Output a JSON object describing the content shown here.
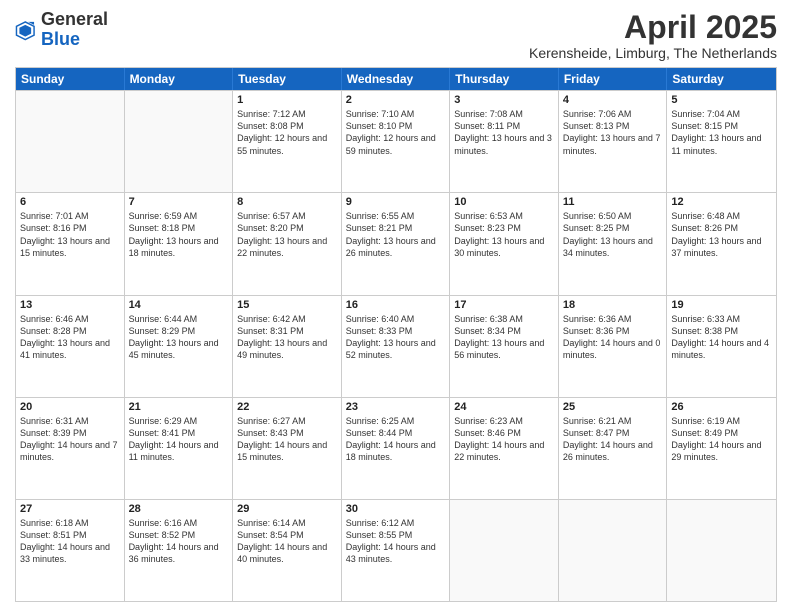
{
  "logo": {
    "general": "General",
    "blue": "Blue"
  },
  "title": "April 2025",
  "subtitle": "Kerensheide, Limburg, The Netherlands",
  "days_of_week": [
    "Sunday",
    "Monday",
    "Tuesday",
    "Wednesday",
    "Thursday",
    "Friday",
    "Saturday"
  ],
  "weeks": [
    [
      {
        "day": "",
        "info": ""
      },
      {
        "day": "",
        "info": ""
      },
      {
        "day": "1",
        "info": "Sunrise: 7:12 AM\nSunset: 8:08 PM\nDaylight: 12 hours and 55 minutes."
      },
      {
        "day": "2",
        "info": "Sunrise: 7:10 AM\nSunset: 8:10 PM\nDaylight: 12 hours and 59 minutes."
      },
      {
        "day": "3",
        "info": "Sunrise: 7:08 AM\nSunset: 8:11 PM\nDaylight: 13 hours and 3 minutes."
      },
      {
        "day": "4",
        "info": "Sunrise: 7:06 AM\nSunset: 8:13 PM\nDaylight: 13 hours and 7 minutes."
      },
      {
        "day": "5",
        "info": "Sunrise: 7:04 AM\nSunset: 8:15 PM\nDaylight: 13 hours and 11 minutes."
      }
    ],
    [
      {
        "day": "6",
        "info": "Sunrise: 7:01 AM\nSunset: 8:16 PM\nDaylight: 13 hours and 15 minutes."
      },
      {
        "day": "7",
        "info": "Sunrise: 6:59 AM\nSunset: 8:18 PM\nDaylight: 13 hours and 18 minutes."
      },
      {
        "day": "8",
        "info": "Sunrise: 6:57 AM\nSunset: 8:20 PM\nDaylight: 13 hours and 22 minutes."
      },
      {
        "day": "9",
        "info": "Sunrise: 6:55 AM\nSunset: 8:21 PM\nDaylight: 13 hours and 26 minutes."
      },
      {
        "day": "10",
        "info": "Sunrise: 6:53 AM\nSunset: 8:23 PM\nDaylight: 13 hours and 30 minutes."
      },
      {
        "day": "11",
        "info": "Sunrise: 6:50 AM\nSunset: 8:25 PM\nDaylight: 13 hours and 34 minutes."
      },
      {
        "day": "12",
        "info": "Sunrise: 6:48 AM\nSunset: 8:26 PM\nDaylight: 13 hours and 37 minutes."
      }
    ],
    [
      {
        "day": "13",
        "info": "Sunrise: 6:46 AM\nSunset: 8:28 PM\nDaylight: 13 hours and 41 minutes."
      },
      {
        "day": "14",
        "info": "Sunrise: 6:44 AM\nSunset: 8:29 PM\nDaylight: 13 hours and 45 minutes."
      },
      {
        "day": "15",
        "info": "Sunrise: 6:42 AM\nSunset: 8:31 PM\nDaylight: 13 hours and 49 minutes."
      },
      {
        "day": "16",
        "info": "Sunrise: 6:40 AM\nSunset: 8:33 PM\nDaylight: 13 hours and 52 minutes."
      },
      {
        "day": "17",
        "info": "Sunrise: 6:38 AM\nSunset: 8:34 PM\nDaylight: 13 hours and 56 minutes."
      },
      {
        "day": "18",
        "info": "Sunrise: 6:36 AM\nSunset: 8:36 PM\nDaylight: 14 hours and 0 minutes."
      },
      {
        "day": "19",
        "info": "Sunrise: 6:33 AM\nSunset: 8:38 PM\nDaylight: 14 hours and 4 minutes."
      }
    ],
    [
      {
        "day": "20",
        "info": "Sunrise: 6:31 AM\nSunset: 8:39 PM\nDaylight: 14 hours and 7 minutes."
      },
      {
        "day": "21",
        "info": "Sunrise: 6:29 AM\nSunset: 8:41 PM\nDaylight: 14 hours and 11 minutes."
      },
      {
        "day": "22",
        "info": "Sunrise: 6:27 AM\nSunset: 8:43 PM\nDaylight: 14 hours and 15 minutes."
      },
      {
        "day": "23",
        "info": "Sunrise: 6:25 AM\nSunset: 8:44 PM\nDaylight: 14 hours and 18 minutes."
      },
      {
        "day": "24",
        "info": "Sunrise: 6:23 AM\nSunset: 8:46 PM\nDaylight: 14 hours and 22 minutes."
      },
      {
        "day": "25",
        "info": "Sunrise: 6:21 AM\nSunset: 8:47 PM\nDaylight: 14 hours and 26 minutes."
      },
      {
        "day": "26",
        "info": "Sunrise: 6:19 AM\nSunset: 8:49 PM\nDaylight: 14 hours and 29 minutes."
      }
    ],
    [
      {
        "day": "27",
        "info": "Sunrise: 6:18 AM\nSunset: 8:51 PM\nDaylight: 14 hours and 33 minutes."
      },
      {
        "day": "28",
        "info": "Sunrise: 6:16 AM\nSunset: 8:52 PM\nDaylight: 14 hours and 36 minutes."
      },
      {
        "day": "29",
        "info": "Sunrise: 6:14 AM\nSunset: 8:54 PM\nDaylight: 14 hours and 40 minutes."
      },
      {
        "day": "30",
        "info": "Sunrise: 6:12 AM\nSunset: 8:55 PM\nDaylight: 14 hours and 43 minutes."
      },
      {
        "day": "",
        "info": ""
      },
      {
        "day": "",
        "info": ""
      },
      {
        "day": "",
        "info": ""
      }
    ]
  ]
}
